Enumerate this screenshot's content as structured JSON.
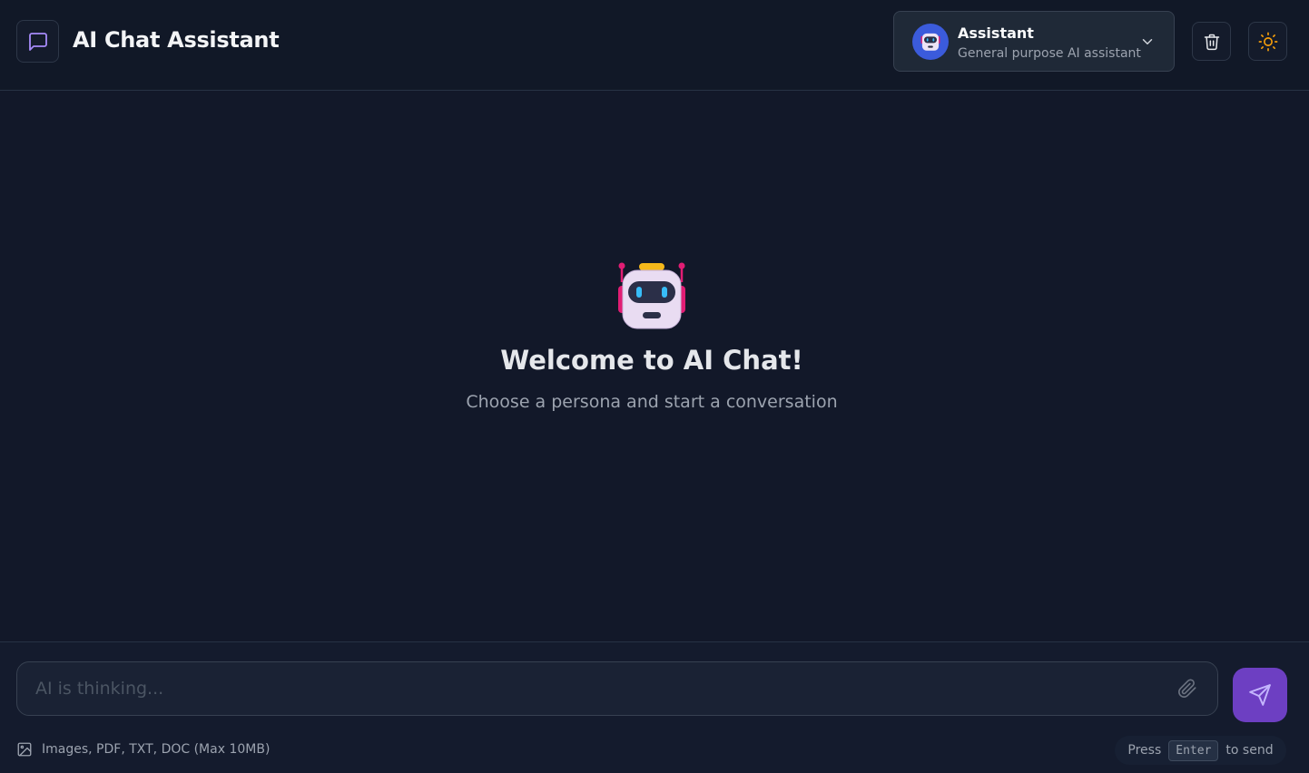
{
  "header": {
    "title": "AI Chat Assistant",
    "logo_icon": "message-square-icon",
    "accent_color": "#a78bfa"
  },
  "persona": {
    "name": "Assistant",
    "description": "General purpose AI assistant",
    "avatar_icon": "robot-icon",
    "dropdown_icon": "chevron-down-icon"
  },
  "actions": {
    "clear_icon": "trash-icon",
    "theme_icon": "sun-icon",
    "theme_icon_color": "#f59e0b"
  },
  "welcome": {
    "icon": "robot-icon",
    "title": "Welcome to AI Chat!",
    "subtitle": "Choose a persona and start a conversation"
  },
  "composer": {
    "placeholder": "AI is thinking...",
    "attach_icon": "paperclip-icon",
    "send_icon": "send-icon",
    "send_color": "#6d3fc2"
  },
  "footer": {
    "file_hint": "Images, PDF, TXT, DOC (Max 10MB)",
    "file_hint_icon": "image-icon",
    "send_hint_prefix": "Press",
    "send_hint_key": "Enter",
    "send_hint_suffix": "to send"
  }
}
